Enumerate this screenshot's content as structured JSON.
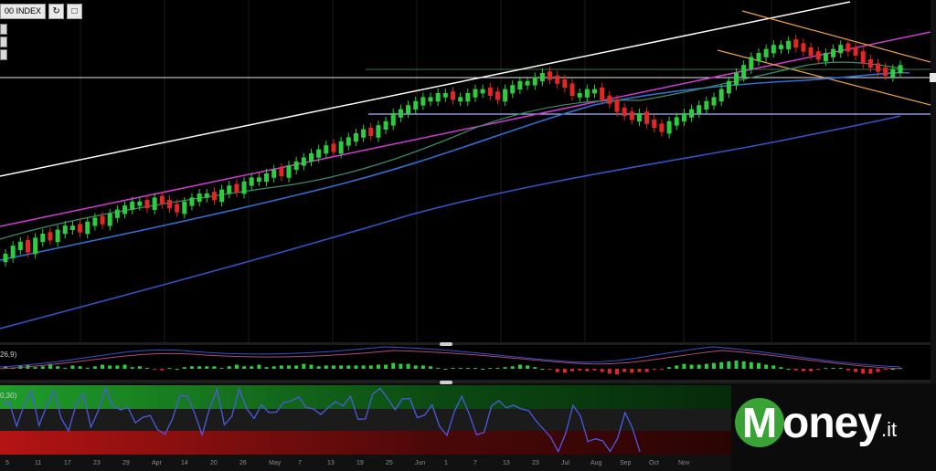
{
  "toolbar": {
    "symbol": "00 INDEX",
    "refresh_icon": "refresh-icon",
    "expand_icon": "expand-icon"
  },
  "macd": {
    "label": "26,9)"
  },
  "rsi": {
    "label": "0,30)"
  },
  "xaxis": {
    "ticks": [
      "5",
      "11",
      "17",
      "23",
      "29",
      "Apr",
      "14",
      "20",
      "26",
      "May",
      "7",
      "13",
      "19",
      "25",
      "Jun",
      "1",
      "7",
      "13",
      "23",
      "Jul",
      "Aug",
      "Sep",
      "Oct",
      "Nov"
    ]
  },
  "logo": {
    "m": "M",
    "word": "oney",
    "tld": ".it"
  },
  "colors": {
    "bull": "#2ecc40",
    "bear": "#e32626",
    "white_trend": "#ffffff",
    "magenta_trend": "#d43ad4",
    "blue_ma": "#2f6fd0",
    "green_ma": "#3a8f6a",
    "channel": "#f0a040",
    "support": "#aab8ff"
  },
  "chart_data": {
    "type": "candlestick",
    "series": [
      {
        "name": "price",
        "values": [
          5,
          7,
          8,
          6,
          9,
          10,
          9,
          11,
          12,
          12,
          11,
          13,
          14,
          13,
          15,
          16,
          17,
          18,
          18,
          17,
          19,
          18,
          17,
          16,
          18,
          19,
          20,
          20,
          19,
          21,
          22,
          21,
          23,
          24,
          24,
          25,
          26,
          25,
          27,
          28,
          29,
          30,
          31,
          32,
          31,
          33,
          34,
          35,
          36,
          35,
          37,
          38,
          40,
          41,
          42,
          43,
          44,
          44,
          45,
          45,
          44,
          44,
          45,
          46,
          46,
          45,
          44,
          46,
          47,
          48,
          48,
          49,
          50,
          49,
          48,
          47,
          45,
          45,
          46,
          46,
          44,
          43,
          41,
          40,
          39,
          40,
          38,
          37,
          36,
          38,
          39,
          40,
          41,
          42,
          43,
          44,
          46,
          48,
          50,
          52,
          54,
          55,
          56,
          57,
          57,
          58,
          57,
          56,
          55,
          54,
          55,
          56,
          57,
          56,
          55,
          53,
          52,
          51,
          50,
          51,
          52
        ]
      }
    ]
  }
}
